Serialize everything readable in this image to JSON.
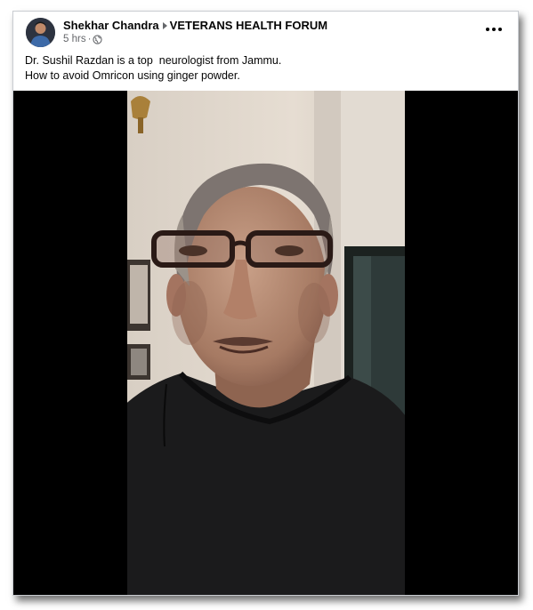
{
  "post": {
    "author": "Shekhar Chandra",
    "group": "VETERANS HEALTH FORUM",
    "time": "5 hrs",
    "separator": "·",
    "privacy_icon": "globe-icon",
    "more_icon": "more-horizontal-icon",
    "text_line1": "Dr. Sushil Razdan is a top  neurologist from Jammu.",
    "text_line2": "How to avoid Omricon using ginger powder."
  },
  "colors": {
    "text_primary": "#050505",
    "text_secondary": "#65676b",
    "video_background": "#000000"
  }
}
